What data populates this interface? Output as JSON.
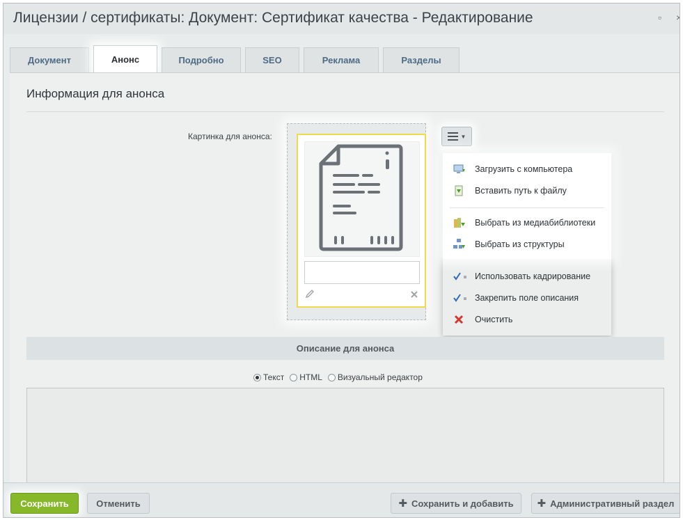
{
  "window": {
    "title": "Лицензии / сертификаты: Документ: Сертификат качества - Редактирование",
    "maximize_glyph": "▫",
    "close_glyph": "×"
  },
  "tabs": [
    {
      "label": "Документ",
      "active": false
    },
    {
      "label": "Анонс",
      "active": true
    },
    {
      "label": "Подробно",
      "active": false
    },
    {
      "label": "SEO",
      "active": false
    },
    {
      "label": "Реклама",
      "active": false
    },
    {
      "label": "Разделы",
      "active": false
    }
  ],
  "section": {
    "title": "Информация для анонса",
    "picture_label": "Картинка для анонса:"
  },
  "picture_card": {
    "description_value": "",
    "icons": {
      "preview": "document-icon",
      "edit": "pencil-icon",
      "delete": "close-icon"
    }
  },
  "menu": {
    "button_icon": "hamburger-icon",
    "items": [
      {
        "label": "Загрузить с компьютера",
        "icon": "computer-upload-icon"
      },
      {
        "label": "Вставить путь к файлу",
        "icon": "file-path-icon"
      },
      {
        "label": "Выбрать из медиабиблиотеки",
        "icon": "media-library-icon"
      },
      {
        "label": "Выбрать из структуры",
        "icon": "structure-icon"
      },
      {
        "label": "Использовать кадрирование",
        "icon": "checkmark-icon",
        "checked": true
      },
      {
        "label": "Закрепить поле описания",
        "icon": "checkmark-icon",
        "checked": true
      },
      {
        "label": "Очистить",
        "icon": "red-x-icon"
      }
    ]
  },
  "description": {
    "header": "Описание для анонса",
    "modes": [
      {
        "label": "Текст",
        "selected": true
      },
      {
        "label": "HTML",
        "selected": false
      },
      {
        "label": "Визуальный редактор",
        "selected": false
      }
    ],
    "text": ""
  },
  "footer": {
    "save": "Сохранить",
    "cancel": "Отменить",
    "save_add": "Сохранить и добавить",
    "admin_section": "Административный раздел"
  },
  "colors": {
    "accent_green": "#86b82a",
    "highlight_yellow": "#f2d94a",
    "tab_text": "#4e6b85"
  }
}
